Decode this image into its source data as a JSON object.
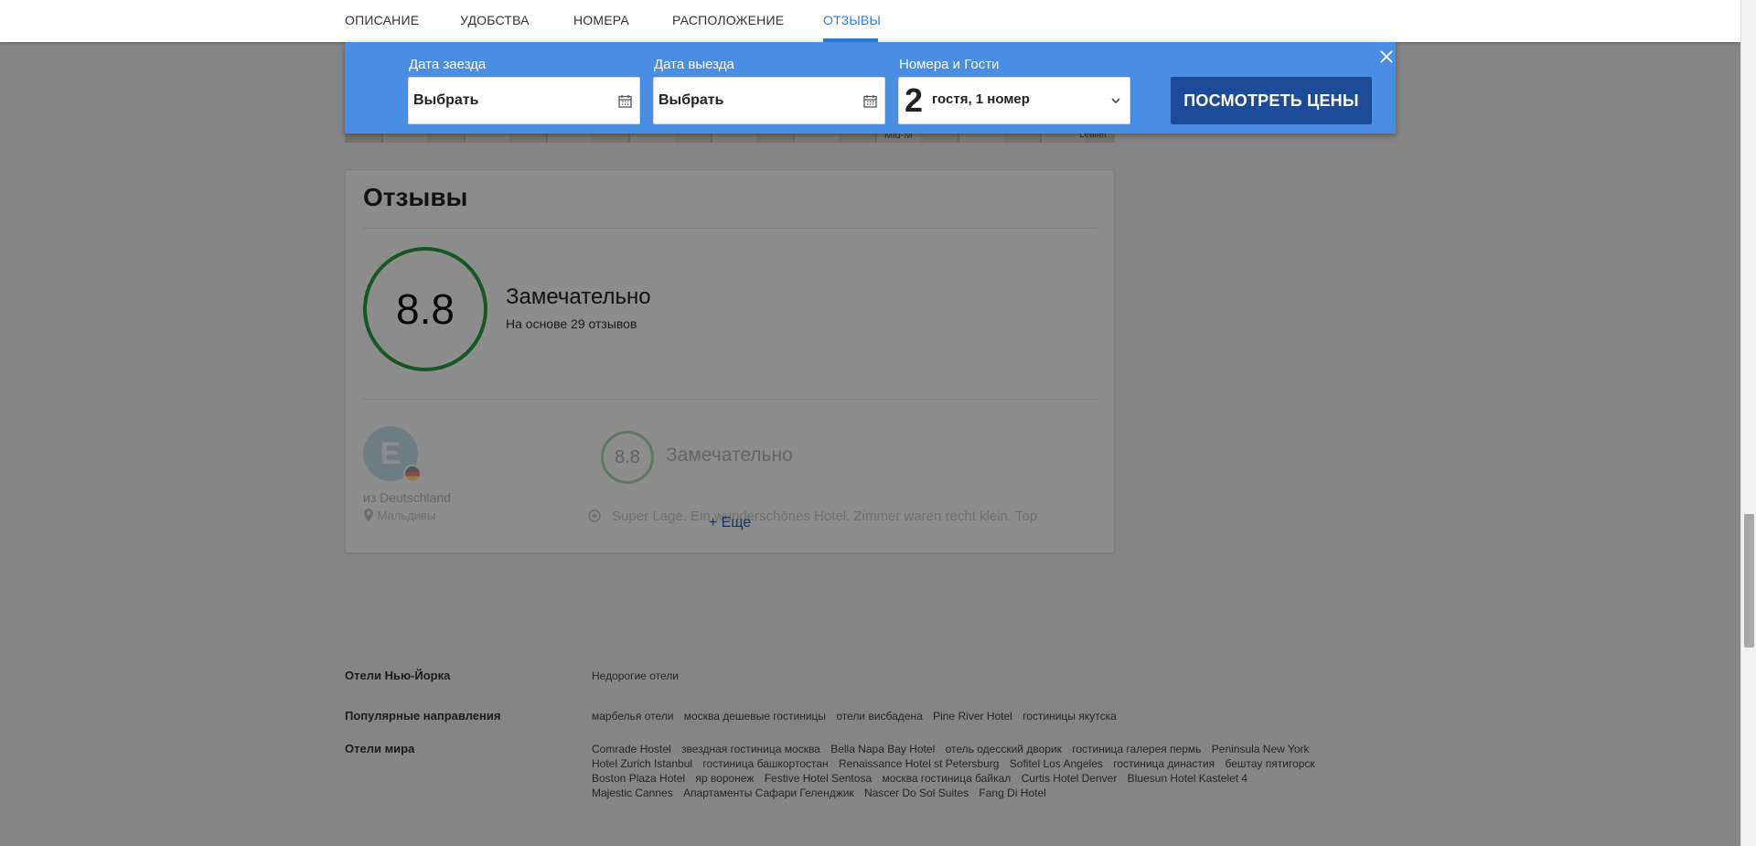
{
  "nav": {
    "tabs": [
      "ОПИСАНИЕ",
      "УДОБСТВА",
      "НОМЕРА",
      "РАСПОЛОЖЕНИЕ",
      "ОТЗЫВЫ"
    ],
    "active_tab": "ОТЗЫВЫ"
  },
  "search": {
    "checkin_label": "Дата заезда",
    "checkin_value": "Выбрать",
    "checkout_label": "Дата выезда",
    "checkout_value": "Выбрать",
    "guests_label": "Номера и Гости",
    "guests_count": "2",
    "guests_text": "гостя, 1 номер",
    "cta_label": "ПОСМОТРЕТЬ ЦЕНЫ",
    "accent_color": "#4a8ee4",
    "cta_color": "#1c4b97"
  },
  "map": {
    "labels": [
      "Mid-M",
      "Leaflet"
    ]
  },
  "reviews": {
    "title": "Отзывы",
    "score": "8.8",
    "score_word": "Замечательно",
    "basis_prefix": "На основе",
    "basis_count": "29",
    "basis_suffix": "отзывов",
    "reviewer": {
      "initial": "E",
      "from": "из Deutschland",
      "location_text": "Мальдивы",
      "score": "8.8",
      "score_word": "Замечательно",
      "snippet": "Super Lage. Ein wunderschönes Hotel. Zimmer waren recht klein. Top"
    },
    "more_link": "+ Еще"
  },
  "footer": {
    "rows": [
      {
        "label": "Отели Нью-Йорка",
        "links": [
          "Недорогие отели"
        ]
      },
      {
        "label": "Популярные направления",
        "links": [
          "марбелья отели",
          "москва дешевые гостиницы",
          "отели висбадена",
          "Pine River Hotel",
          "гостиницы якутска"
        ]
      },
      {
        "label": "Отели мира",
        "links": [
          "Comrade Hostel",
          "звездная гостиница москва",
          "Bella Napa Bay Hotel",
          "отель одесский дворик",
          "гостиница галерея пермь",
          "Peninsula New York",
          "Hotel Zurich Istanbul",
          "гостиница башкортостан",
          "Renaissance Hotel st Petersburg",
          "Sofitel Los Angeles",
          "гостиница династия",
          "бештау пятигорск",
          "Boston Plaza Hotel",
          "яр воронеж",
          "Festive Hotel Sentosa",
          "москва гостиница байкал",
          "Curtis Hotel Denver",
          "Bluesun Hotel Kastelet 4",
          "Majestic Cannes",
          "Апартаменты Сафари Геленджик",
          "Nascer Do Sol Suites",
          "Fang Di Hotel"
        ]
      }
    ]
  }
}
